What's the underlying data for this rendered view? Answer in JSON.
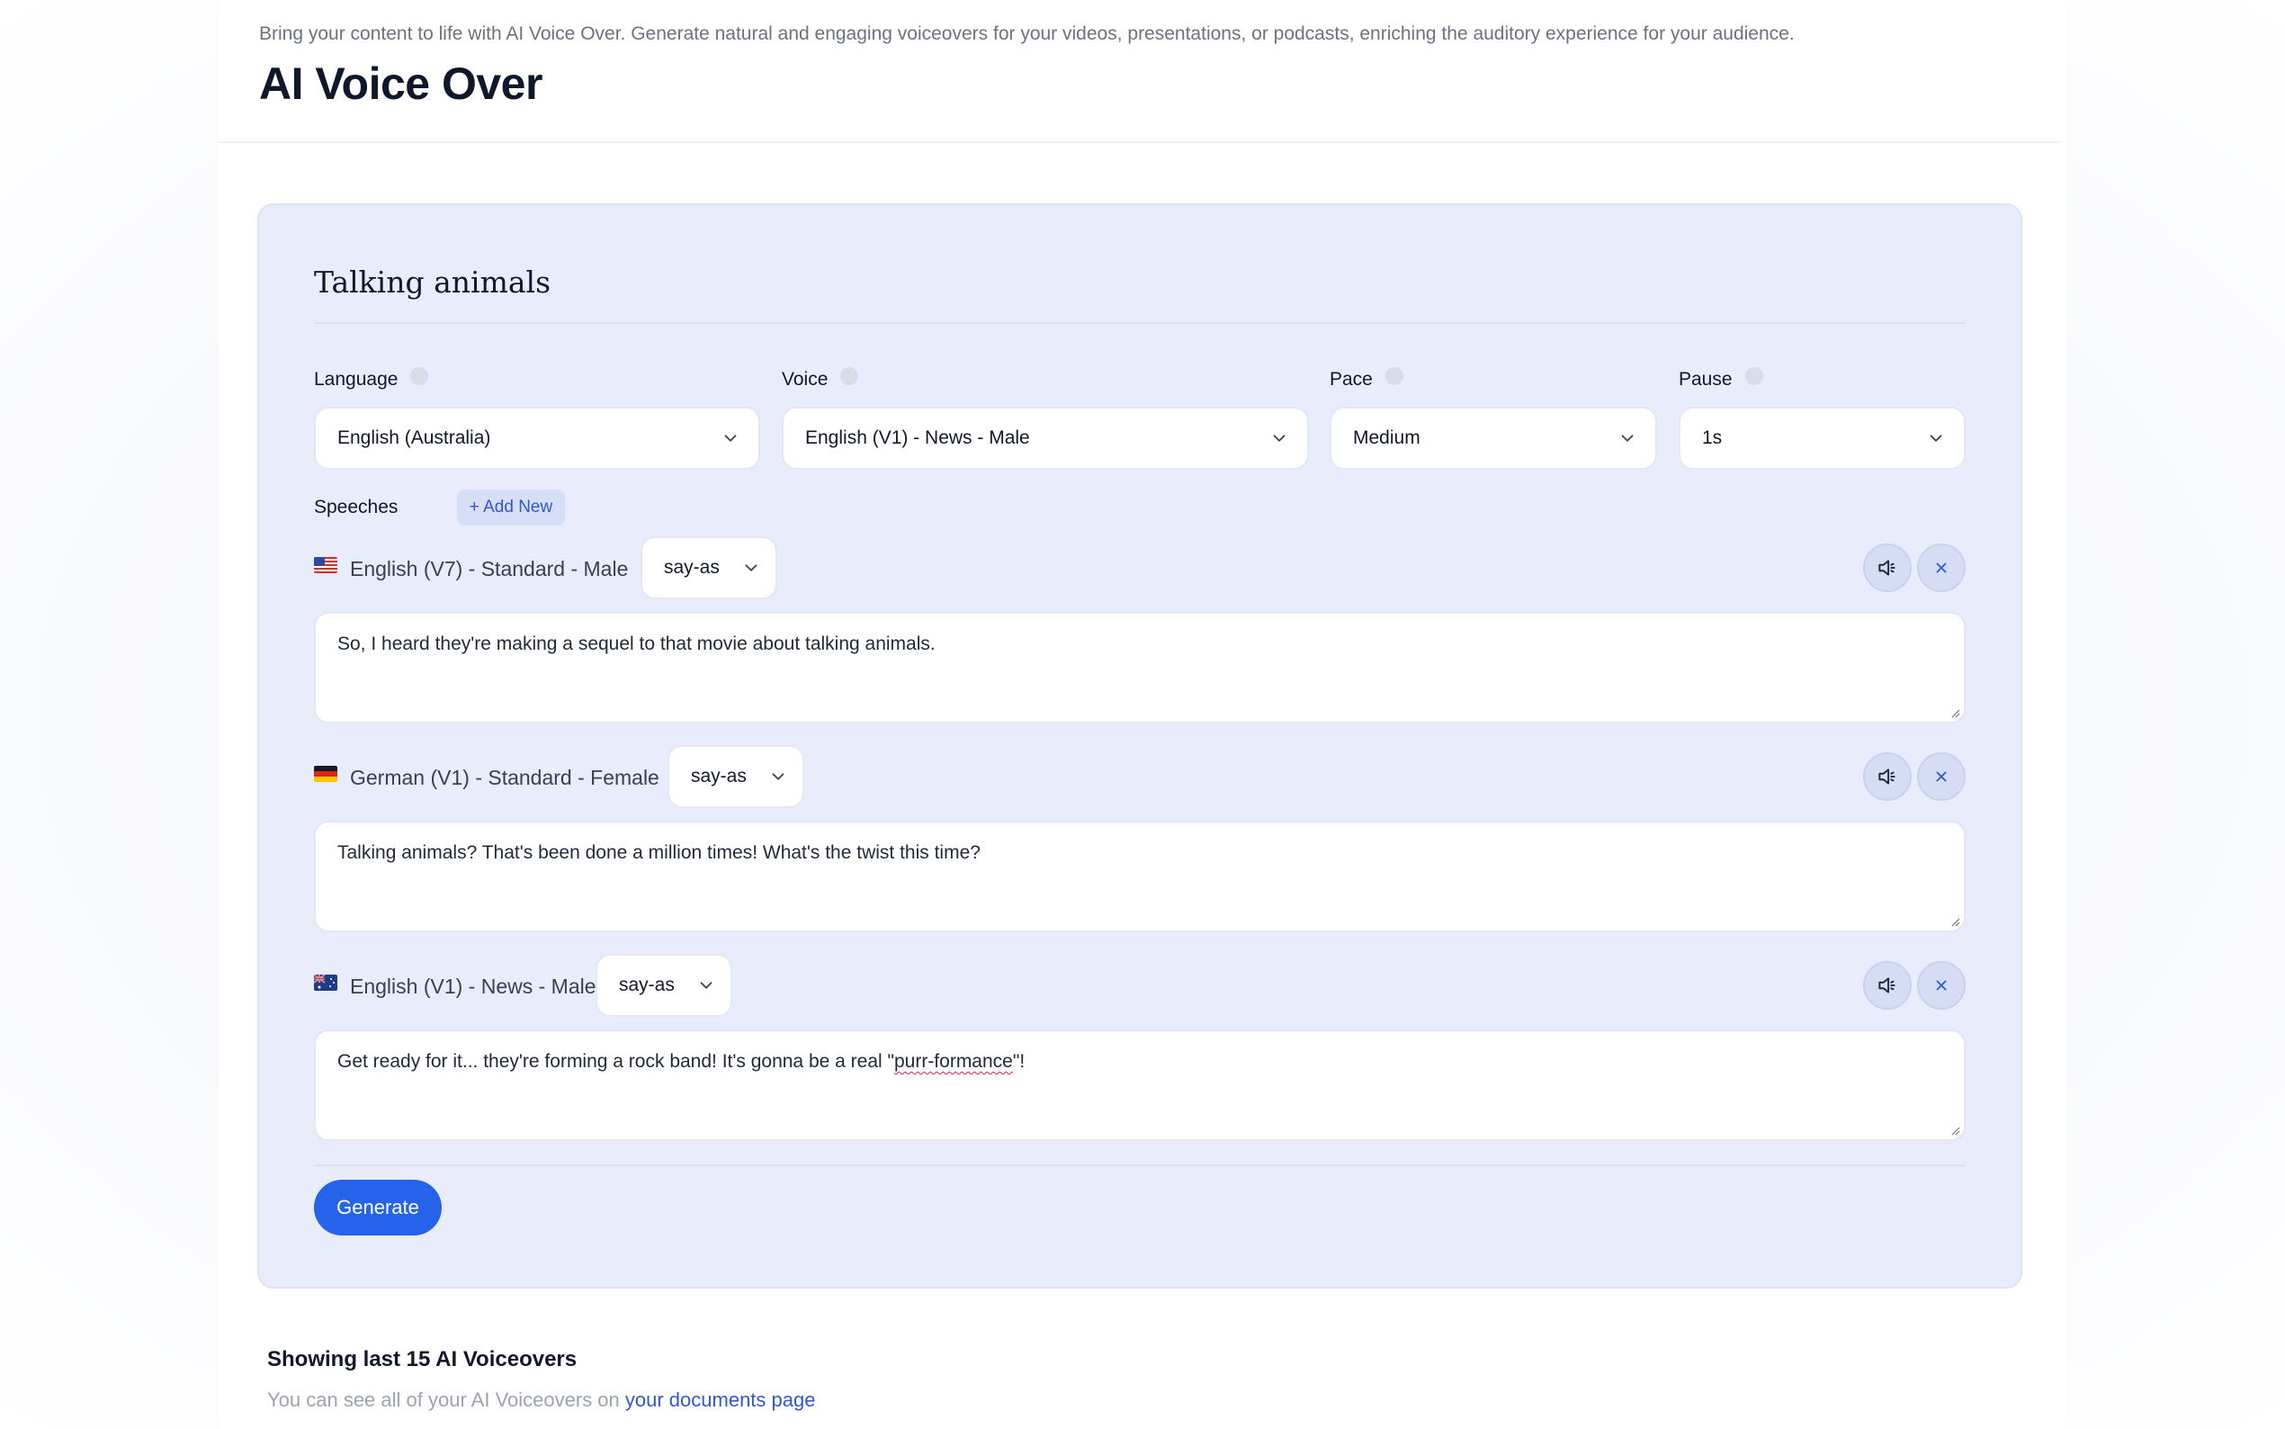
{
  "header": {
    "subtitle": "Bring your content to life with AI Voice Over. Generate natural and engaging voiceovers for your videos, presentations, or podcasts, enriching the auditory experience for your audience.",
    "title": "AI Voice Over"
  },
  "project": {
    "title": "Talking animals",
    "language": {
      "label": "Language",
      "value": "English (Australia)"
    },
    "voice": {
      "label": "Voice",
      "value": "English (V1) - News - Male"
    },
    "pace": {
      "label": "Pace",
      "value": "Medium"
    },
    "pause": {
      "label": "Pause",
      "value": "1s"
    }
  },
  "speeches": {
    "label": "Speeches",
    "add_new_label": "+ Add New",
    "items": [
      {
        "flag": "us-flag",
        "voice": "English (V7) - Standard - Male",
        "say_as": "say-as",
        "text": "So, I heard they're making a sequel to that movie about talking animals."
      },
      {
        "flag": "de-flag",
        "voice": "German (V1) - Standard - Female",
        "say_as": "say-as",
        "text": "Talking animals? That's been done a million times! What's the twist this time?"
      },
      {
        "flag": "au-flag",
        "voice": "English (V1) - News - Male",
        "say_as": "say-as",
        "text_before": "Get ready for it... they're forming a rock band! It's gonna be a real \"",
        "text_misspelled": "purr-formance",
        "text_after": "\"!"
      }
    ]
  },
  "generate_label": "Generate",
  "history": {
    "title": "Showing last 15 AI Voiceovers",
    "subtitle_prefix": "You can see all of your AI Voiceovers on ",
    "link_text": "your documents page"
  },
  "colors": {
    "accent": "#2563eb",
    "card_bg": "#e8ecfb",
    "link": "#2f57d6"
  }
}
